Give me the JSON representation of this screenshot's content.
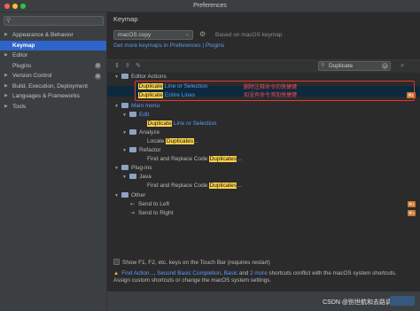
{
  "window": {
    "title": "Preferences",
    "colors": {
      "close": "#ff5f57",
      "minimize": "#febc2e",
      "zoom": "#28c840"
    }
  },
  "sidebar": {
    "search_icon": "search-icon",
    "items": [
      {
        "label": "Appearance & Behavior",
        "expandable": true,
        "selected": false
      },
      {
        "label": "Keymap",
        "expandable": false,
        "selected": true
      },
      {
        "label": "Editor",
        "expandable": true,
        "selected": false
      },
      {
        "label": "Plugins",
        "expandable": false,
        "selected": false,
        "badge": true
      },
      {
        "label": "Version Control",
        "expandable": true,
        "selected": false,
        "badge": true
      },
      {
        "label": "Build, Execution, Deployment",
        "expandable": true,
        "selected": false
      },
      {
        "label": "Languages & Frameworks",
        "expandable": true,
        "selected": false
      },
      {
        "label": "Tools",
        "expandable": true,
        "selected": false
      }
    ]
  },
  "main": {
    "title": "Keymap",
    "keymap_select": "macOS copy",
    "based_on": "Based on macOS keymap",
    "more_link": "Get more keymaps in Preferences | Plugins",
    "filter_value": "Duplicate"
  },
  "tree": {
    "editor_actions": "Editor Actions",
    "dup_line_sel_hl": "Duplicate",
    "dup_line_sel_rest": " Line or Selection",
    "dup_entire_hl": "Duplicate",
    "dup_entire_rest": " Entire Lines",
    "note1": "删除注释命令的快捷键",
    "note2": "如没有命令添加快捷键",
    "sc_selection": "⌘D",
    "main_menu": "Main menu",
    "edit": "Edit",
    "edit_dup_hl": "Duplicate",
    "edit_dup_rest": " Line or Selection",
    "analyze": "Analyze",
    "locate_pre": "Locate ",
    "locate_hl": "Duplicates",
    "locate_post": "...",
    "refactor": "Refactor",
    "fr_pre": "Find and Replace Code ",
    "fr_hl": "Duplicates",
    "fr_post": "...",
    "plugins": "Plug-ins",
    "java": "Java",
    "fr2_pre": "Find and Replace Code ",
    "fr2_hl": "Duplicates",
    "fr2_post": "...",
    "other": "Other",
    "send_left": "Send to Left",
    "send_right": "Send to Right",
    "sc_left": "⌘1",
    "sc_right": "⌘1"
  },
  "footer": {
    "touch_bar": "Show F1, F2, etc. keys on the Touch Bar (requires restart)",
    "warn_pre": "",
    "warn_link1": "Find Action...",
    "warn_sep1": ", ",
    "warn_link2": "Second Basic Completion",
    "warn_sep2": ", ",
    "warn_link3": "Basic",
    "warn_mid": " and ",
    "warn_link4": "2 more",
    "warn_rest": " shortcuts conflict with the macOS system shortcuts.",
    "warn_line2": "Assign custom shortcuts or change the macOS system settings.",
    "watermark": "CSDN @别世航和去路调"
  }
}
